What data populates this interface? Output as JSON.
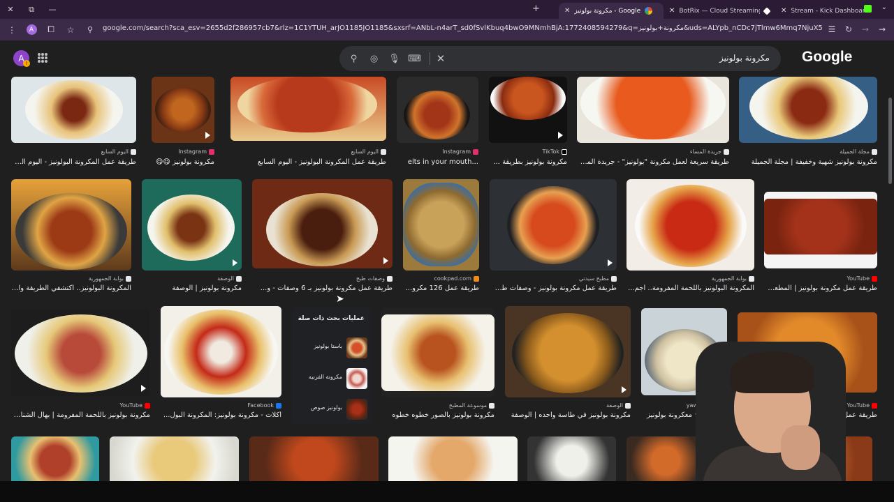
{
  "browser": {
    "tabs": [
      {
        "title": "Google - مكرونة بولونيز",
        "active": true
      },
      {
        "title": "BotRix — Cloud Streaming Bot",
        "active": false
      },
      {
        "title": "Stream - Kick Dashboard",
        "active": false
      }
    ],
    "url": "google.com/search?sca_esv=2655d2f286957cb7&rlz=1C1YTUH_arJO1185JO1185&sxsrf=ANbL-n4arT_sd0fSvlKbuq4bwO9MNmhBjA:1772408594279&q=مكرونة+بولونيز&uds=ALYpb_nCDc7jTlmw6Mmq7NjuX5c-2gfRySh V6Ek1WIF3L5cu-UaJ1SZ6ee...",
    "profile_letter": "A"
  },
  "google": {
    "logo": "Google",
    "query": "مكرونة بولونيز",
    "avatar_letter": "A"
  },
  "results": [
    {
      "source": "اليوم السابع",
      "title": "طريقة عمل المكرونة البولونيز - اليوم السابع"
    },
    {
      "source": "Instagram",
      "title": "مكرونة بولونيز 😋😋"
    },
    {
      "source": "اليوم السابع",
      "title": "طريقة عمل المكرونة البولونيز - اليوم السابع"
    },
    {
      "source": "Instagram",
      "title": "...elts in your mouth"
    },
    {
      "source": "TikTok",
      "title": "مكرونة بولونيز بطريقة ..."
    },
    {
      "source": "جريدة المساء",
      "title": "طريقة سريعة لعمل مكرونة \"بولونيز\" - جريدة المساء"
    },
    {
      "source": "مجلة الجميلة",
      "title": "مكرونة بولونيز شهية وخفيفة | مجلة الجميلة"
    },
    {
      "source": "بوابة الجمهورية",
      "title": "المكرونة البولونيز.. اكتشفي الطريقة والد..."
    },
    {
      "source": "الوصفة",
      "title": "مكرونة بولونيز | الوصفة"
    },
    {
      "source": "وصفات طبخ",
      "title": "طريقة عمل مكرونة بولونيز بـ 6 وصفات - و..."
    },
    {
      "source": "cookpad.com",
      "title": "طريقة عمل 126 مكرو..."
    },
    {
      "source": "مطبخ سيدتي",
      "title": "طريقة عمل مكرونة بولونيز - وصفات طب..."
    },
    {
      "source": "بوابة الجمهورية",
      "title": "المكرونة البولونيز باللحمة المفرومة.. أجم..."
    },
    {
      "source": "YouTube",
      "title": "طريقة عمل مكرونة بولونيز | المطعم..."
    },
    {
      "source": "YouTube",
      "title": "مكرونة بولونيز باللحمة المفرومة | بهال الشناو..."
    },
    {
      "source": "Facebook",
      "title": "أكلات - مكرونة بولونيز: المكرونة البول..."
    },
    {
      "source": "موسوعة المطبخ",
      "title": "مكرونة بولونيز بالصور خطوه خطوه"
    },
    {
      "source": "الوصفة",
      "title": "مكرونة بولونيز في طاسة واحده | الوصفة"
    },
    {
      "source": "yawmy.com",
      "title": "Yawmy ★ معكرونة بولونيز"
    },
    {
      "source": "YouTube",
      "title": "طريقة عمل مكرونة ب..."
    }
  ],
  "related": {
    "title": "عمليات بحث ذات صلة",
    "items": [
      "باستا بولونيز",
      "مكرونة الفرنيه",
      "بولونيز صوص"
    ]
  },
  "colors": {
    "tabbar": "#2b1b35",
    "toolbar": "#3c2b48",
    "page_bg": "#1f1f1f",
    "searchbox": "#303134"
  }
}
